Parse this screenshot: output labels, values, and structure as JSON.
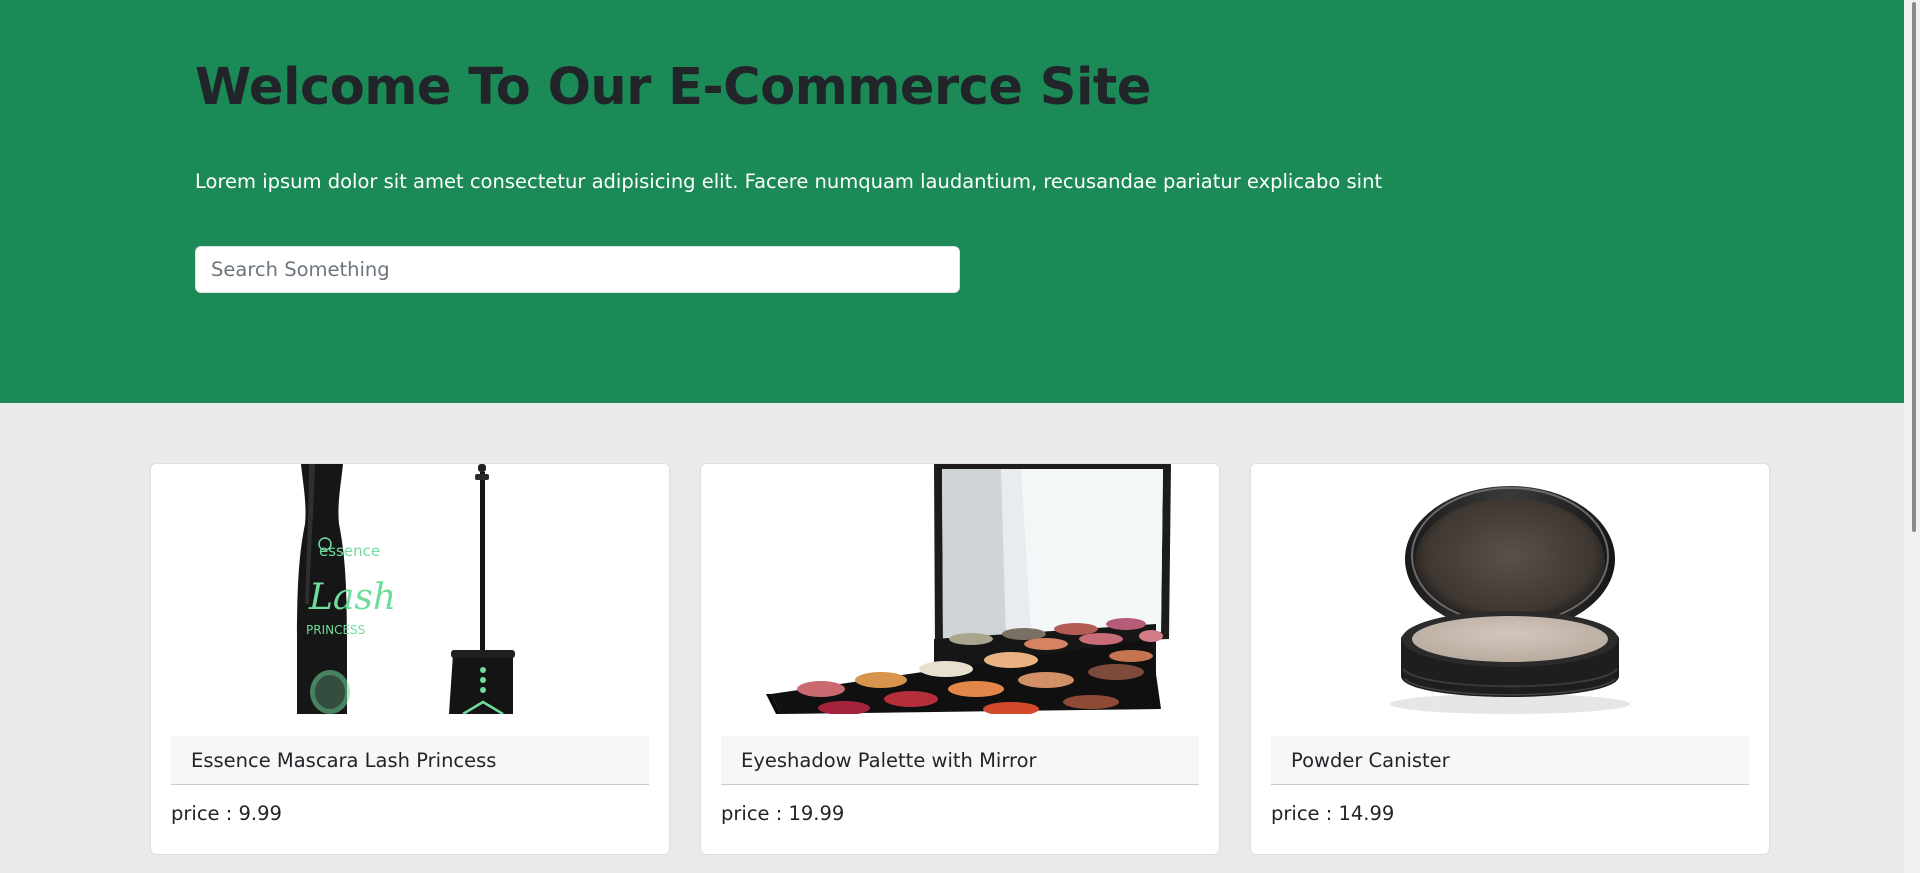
{
  "hero": {
    "title": "Welcome To Our E-Commerce Site",
    "subtitle": "Lorem ipsum dolor sit amet consectetur adipisicing elit. Facere numquam laudantium, recusandae pariatur explicabo sint",
    "search_placeholder": "Search Something",
    "search_value": "",
    "background_color": "#1b8a56"
  },
  "products": [
    {
      "name": "Essence Mascara Lash Princess",
      "price_text": "price : 9.99",
      "image_icon": "mascara-image",
      "image_brand_text": "essence",
      "image_product_text": "Lash",
      "image_sub_text": "PRINCESS"
    },
    {
      "name": "Eyeshadow Palette with Mirror",
      "price_text": "price : 19.99",
      "image_icon": "eyeshadow-palette-image"
    },
    {
      "name": "Powder Canister",
      "price_text": "price : 14.99",
      "image_icon": "powder-compact-image"
    }
  ]
}
